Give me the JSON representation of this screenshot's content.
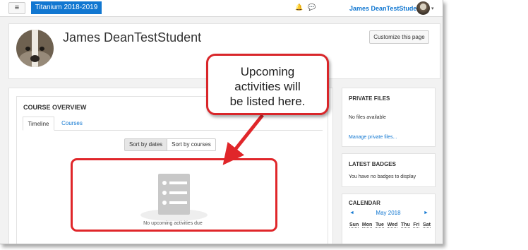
{
  "navbar": {
    "menu_glyph": "≡",
    "brand": "Titanium 2018-2019",
    "bell_glyph": "🔔",
    "chat_glyph": "💬",
    "username": "James DeanTestStudent",
    "caret": "▾"
  },
  "profile": {
    "name": "James DeanTestStudent",
    "customize_label": "Customize this page"
  },
  "course_overview": {
    "title": "COURSE OVERVIEW",
    "tabs": [
      {
        "label": "Timeline",
        "active": true
      },
      {
        "label": "Courses",
        "active": false
      }
    ],
    "sort_by_dates": "Sort by dates",
    "sort_by_courses": "Sort by courses",
    "empty_message": "No upcoming activities due"
  },
  "callout": {
    "text": "Upcoming activities will be listed here."
  },
  "private_files": {
    "title": "PRIVATE FILES",
    "empty": "No files available",
    "manage_link": "Manage private files..."
  },
  "latest_badges": {
    "title": "LATEST BADGES",
    "empty": "You have no badges to display"
  },
  "calendar": {
    "title": "CALENDAR",
    "month": "May 2018",
    "prev": "◄",
    "next": "►",
    "days": [
      "Sun",
      "Mon",
      "Tue",
      "Wed",
      "Thu",
      "Fri",
      "Sat"
    ]
  },
  "colors": {
    "brand_blue": "#1177d1",
    "annotation_red": "#e0262a"
  }
}
